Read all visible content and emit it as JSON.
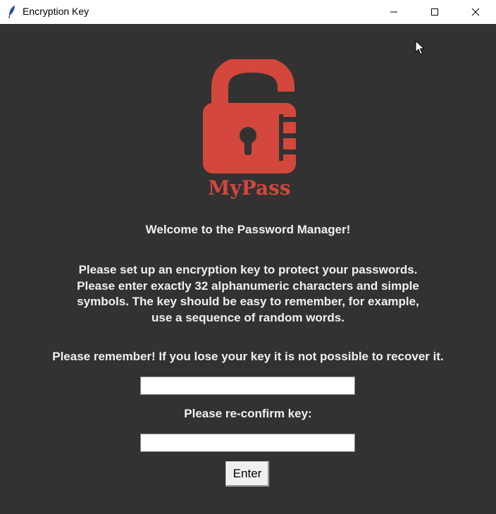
{
  "window": {
    "title": "Encryption Key",
    "controls": [
      "minimize-icon",
      "maximize-icon",
      "close-icon"
    ]
  },
  "logo": {
    "brand_text": "MyPass",
    "icon": "unlocked-padlock-icon",
    "color": "#d3473c"
  },
  "content": {
    "welcome": "Welcome to the Password Manager!",
    "instructions": "Please set up an encryption key to protect your passwords.\nPlease enter exactly 32 alphanumeric characters and simple\nsymbols. The key should be easy to remember, for example,\nuse a sequence of random words.",
    "warning": "Please remember! If you lose your key it is not possible to recover it.",
    "key_value": "",
    "confirm_label": "Please re-confirm key:",
    "confirm_value": "",
    "enter_button": "Enter"
  },
  "colors": {
    "background": "#323232",
    "text": "#f0f0f0",
    "accent": "#d3473c"
  }
}
